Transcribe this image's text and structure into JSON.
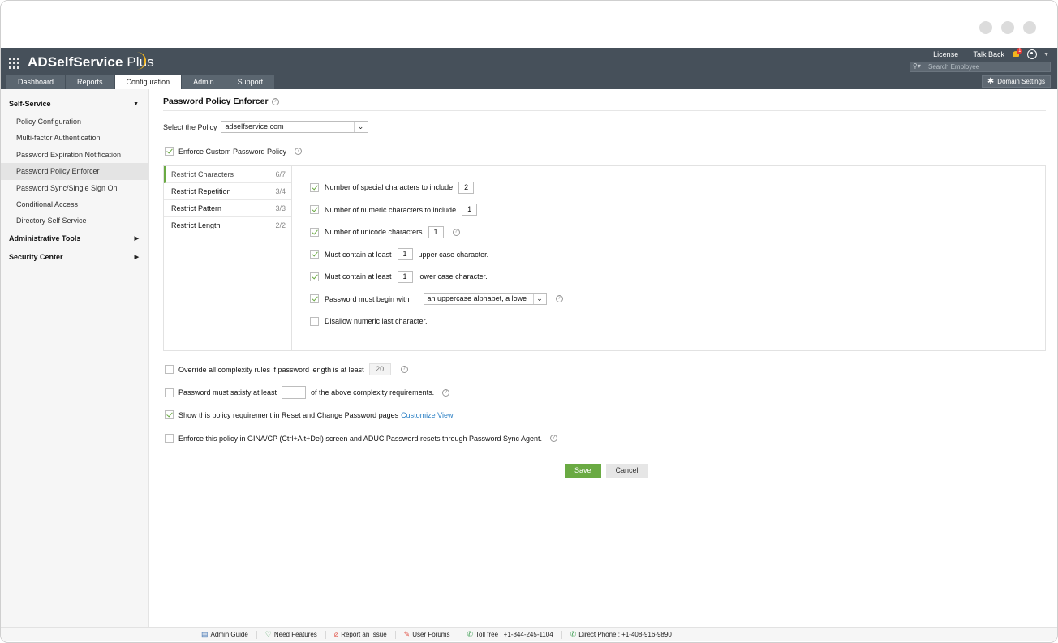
{
  "window": {
    "dots": [
      "",
      "",
      ""
    ]
  },
  "header": {
    "brand": "ADSelfService",
    "brand_plus": " Plus",
    "top_links": [
      "License",
      "Talk Back"
    ],
    "notification_count": "1",
    "search_placeholder": "Search Employee",
    "domain_settings_label": "Domain Settings",
    "tabs": [
      "Dashboard",
      "Reports",
      "Configuration",
      "Admin",
      "Support"
    ],
    "active_tab": "Configuration"
  },
  "sidebar": {
    "sections": [
      {
        "label": "Self-Service",
        "arrow": "▼",
        "items": [
          "Policy Configuration",
          "Multi-factor Authentication",
          "Password Expiration Notification",
          "Password Policy Enforcer",
          "Password Sync/Single Sign On",
          "Conditional Access",
          "Directory Self Service"
        ]
      },
      {
        "label": "Administrative Tools",
        "arrow": "▶"
      },
      {
        "label": "Security Center",
        "arrow": "▶"
      }
    ],
    "active_item": "Password Policy Enforcer"
  },
  "main": {
    "title": "Password Policy Enforcer",
    "select_policy_label": "Select the Policy",
    "select_policy_value": "adselfservice.com",
    "enforce_custom_label": "Enforce Custom Password Policy",
    "rule_tabs": [
      {
        "label": "Restrict Characters",
        "count": "6/7"
      },
      {
        "label": "Restrict Repetition",
        "count": "3/4"
      },
      {
        "label": "Restrict Pattern",
        "count": "3/3"
      },
      {
        "label": "Restrict Length",
        "count": "2/2"
      }
    ],
    "options": {
      "special": {
        "label": "Number of special characters to include",
        "value": "2"
      },
      "numeric": {
        "label": "Number of numeric characters to include",
        "value": "1"
      },
      "unicode": {
        "label": "Number of unicode characters",
        "value": "1"
      },
      "upper": {
        "prefix": "Must contain at least",
        "value": "1",
        "suffix": "upper case character."
      },
      "lower": {
        "prefix": "Must contain at least",
        "value": "1",
        "suffix": "lower case character."
      },
      "begin": {
        "label": "Password must begin with",
        "value": "an uppercase alphabet, a lowe"
      },
      "disallow": {
        "label": "Disallow numeric last character."
      }
    },
    "override": {
      "label": "Override all complexity rules if password length is at least",
      "value": "20"
    },
    "satisfy": {
      "prefix": "Password must satisfy at least",
      "value": "",
      "suffix": "of the above complexity requirements."
    },
    "show_req": {
      "label": "Show this policy requirement in Reset and Change Password pages",
      "link": "Customize View"
    },
    "gina": {
      "label": "Enforce this policy in GINA/CP (Ctrl+Alt+Del) screen and ADUC Password resets through Password Sync Agent."
    },
    "save_label": "Save",
    "cancel_label": "Cancel"
  },
  "footer": {
    "items": [
      {
        "icon": "admin-guide-icon",
        "label": "Admin Guide"
      },
      {
        "icon": "need-features-icon",
        "label": "Need Features"
      },
      {
        "icon": "report-issue-icon",
        "label": "Report an Issue"
      },
      {
        "icon": "user-forums-icon",
        "label": "User Forums"
      },
      {
        "icon": "phone-icon",
        "label": "Toll free : +1-844-245-1104"
      },
      {
        "icon": "phone-icon",
        "label": "Direct Phone : +1-408-916-9890"
      }
    ]
  },
  "colors": {
    "header_bg": "#46505a",
    "accent_green": "#6aaa43",
    "link_blue": "#2a7fc4",
    "brand_arc": "#f3b51d"
  }
}
